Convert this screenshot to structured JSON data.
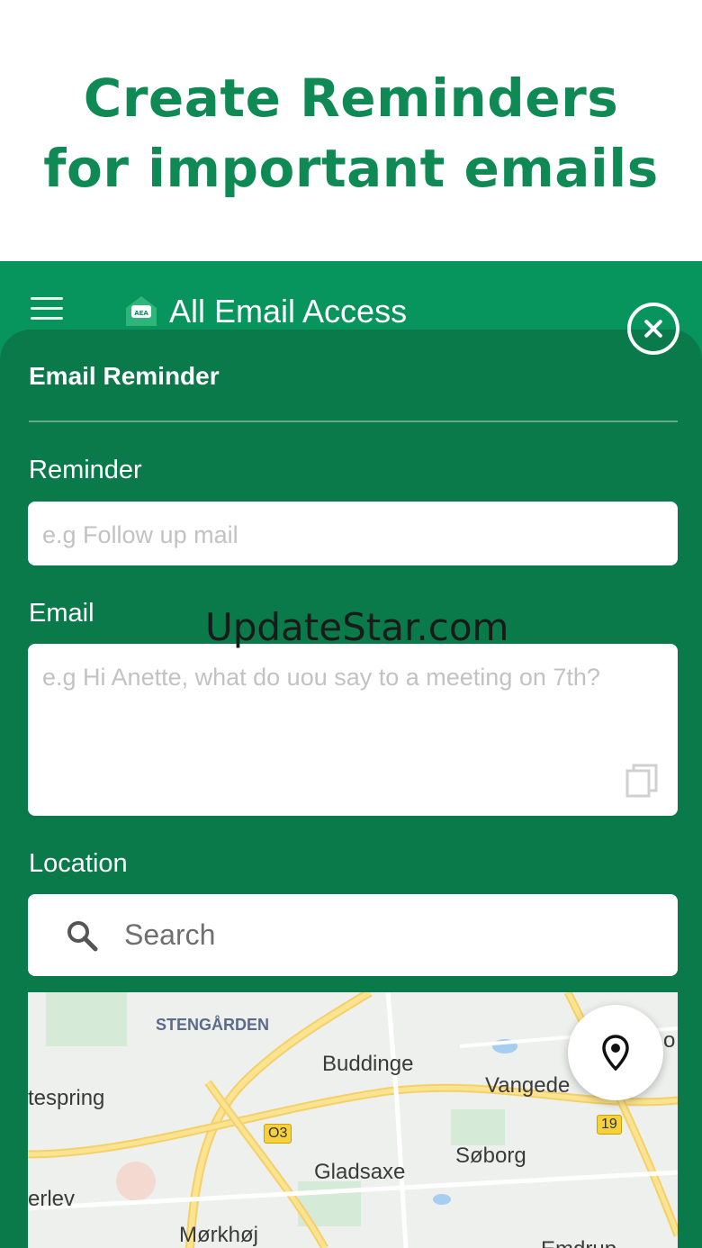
{
  "promo": {
    "line1": "Create Reminders",
    "line2": "for important emails"
  },
  "appbar": {
    "title": "All Email Access",
    "menu_icon": "hamburger-menu-icon",
    "logo_icon": "envelope-logo-icon"
  },
  "sheet": {
    "title": "Email Reminder",
    "close_icon": "close-circle-icon",
    "reminder": {
      "label": "Reminder",
      "placeholder": "e.g Follow up mail",
      "value": ""
    },
    "email": {
      "label": "Email",
      "placeholder": "e.g Hi Anette, what do uou say to a meeting on 7th?",
      "value": "",
      "paste_icon": "copy-icon"
    },
    "location": {
      "label": "Location",
      "search_placeholder": "Search",
      "search_icon": "search-icon"
    }
  },
  "map": {
    "labels": [
      "STENGÅRDEN",
      "Buddinge",
      "Vangede",
      "tespring",
      "Gladsaxe",
      "Søborg",
      "erlev",
      "Mørkhøj",
      "Emdrup",
      "o"
    ],
    "road_badges": [
      "O3",
      "19"
    ],
    "fab_icon": "location-pin-icon"
  },
  "watermark": "UpdateStar.com",
  "colors": {
    "brand_green": "#0f8a55",
    "appbar_green": "#07955d",
    "sheet_green": "#0a7a4b",
    "road_yellow": "#f6d13b"
  }
}
